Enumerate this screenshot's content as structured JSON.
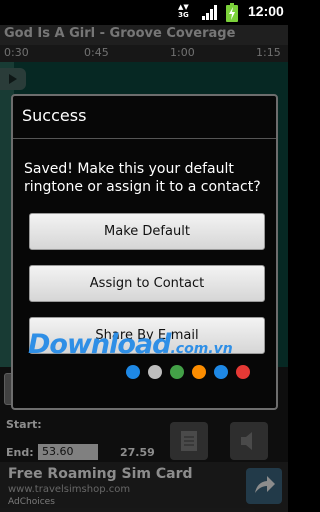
{
  "status_bar": {
    "network": "3G",
    "time": "12:00",
    "icons": [
      "signal-icon",
      "battery-charging-icon"
    ]
  },
  "app": {
    "title": "God Is A Girl - Groove Coverage",
    "timeline_ticks": [
      "0:30",
      "0:45",
      "1:00",
      "1:15"
    ],
    "start_label": "Start:",
    "end_label": "End:",
    "end_value": "53.60",
    "length_value": "27.59",
    "colors": {
      "waveform": "#0c4a40",
      "titlebar": "#3a3a3a"
    }
  },
  "dialog": {
    "title": "Success",
    "message": "Saved! Make this your default ringtone or assign it to a contact?",
    "buttons": {
      "make_default": "Make Default",
      "assign_contact": "Assign to Contact",
      "share_email": "Share By E-mail"
    }
  },
  "ad": {
    "title": "Free Roaming Sim Card",
    "url": "www.travelsimshop.com",
    "choices_label": "AdChoices",
    "arrow_icon": "share-arrow-icon"
  },
  "watermark": {
    "text": "Download",
    "domain": ".com.vn",
    "dot_colors": [
      "#1e88e5",
      "#bdbdbd",
      "#43a047",
      "#fb8c00",
      "#1e88e5",
      "#e53935"
    ]
  }
}
